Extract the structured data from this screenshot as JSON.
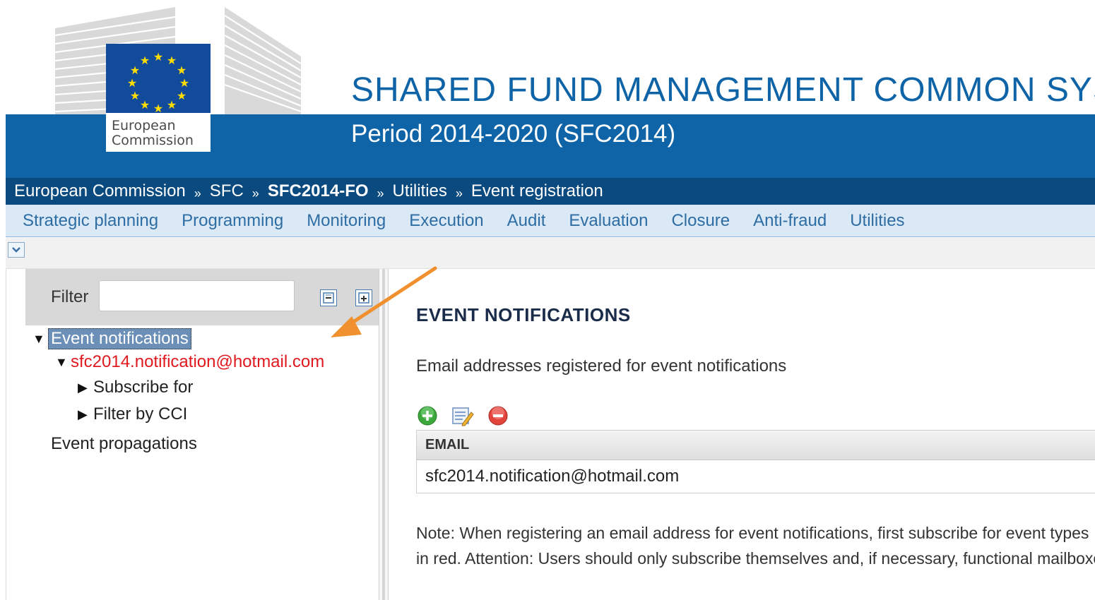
{
  "header": {
    "logo_line1": "European",
    "logo_line2": "Commission",
    "title": "SHARED FUND MANAGEMENT COMMON SYSTEM",
    "subtitle": "Period 2014-2020 (SFC2014)",
    "brand_color": "#0e64a6"
  },
  "breadcrumb": {
    "items": [
      "European Commission",
      "SFC",
      "SFC2014-FO",
      "Utilities",
      "Event registration"
    ],
    "separator": "»"
  },
  "mainnav": {
    "items": [
      "Strategic planning",
      "Programming",
      "Monitoring",
      "Execution",
      "Audit",
      "Evaluation",
      "Closure",
      "Anti-fraud",
      "Utilities"
    ]
  },
  "toolbar": {
    "collapse_icon": "chevron-down-icon"
  },
  "left_panel": {
    "filter_label": "Filter",
    "filter_value": "",
    "collapse_all_icon": "collapse-all-icon",
    "expand_all_icon": "expand-all-icon",
    "tree": {
      "root": "Event notifications",
      "email": "sfc2014.notification@hotmail.com",
      "child1": "Subscribe for",
      "child2": "Filter by CCI",
      "root2": "Event propagations"
    }
  },
  "content": {
    "title": "EVENT NOTIFICATIONS",
    "description": "Email addresses registered for event notifications",
    "actions": {
      "add_icon": "add-icon",
      "edit_icon": "edit-icon",
      "delete_icon": "delete-icon"
    },
    "grid": {
      "column": "EMAIL",
      "rows": [
        "sfc2014.notification@hotmail.com"
      ]
    },
    "note_line1": "Note: When registering an email address for event notifications, first subscribe for event types",
    "note_line2": "in red. Attention: Users should only subscribe themselves and, if necessary, functional mailboxes"
  },
  "colors": {
    "accent_red": "#e0191f",
    "annotation_arrow": "#f0902e",
    "nav_text": "#2e6da4"
  }
}
